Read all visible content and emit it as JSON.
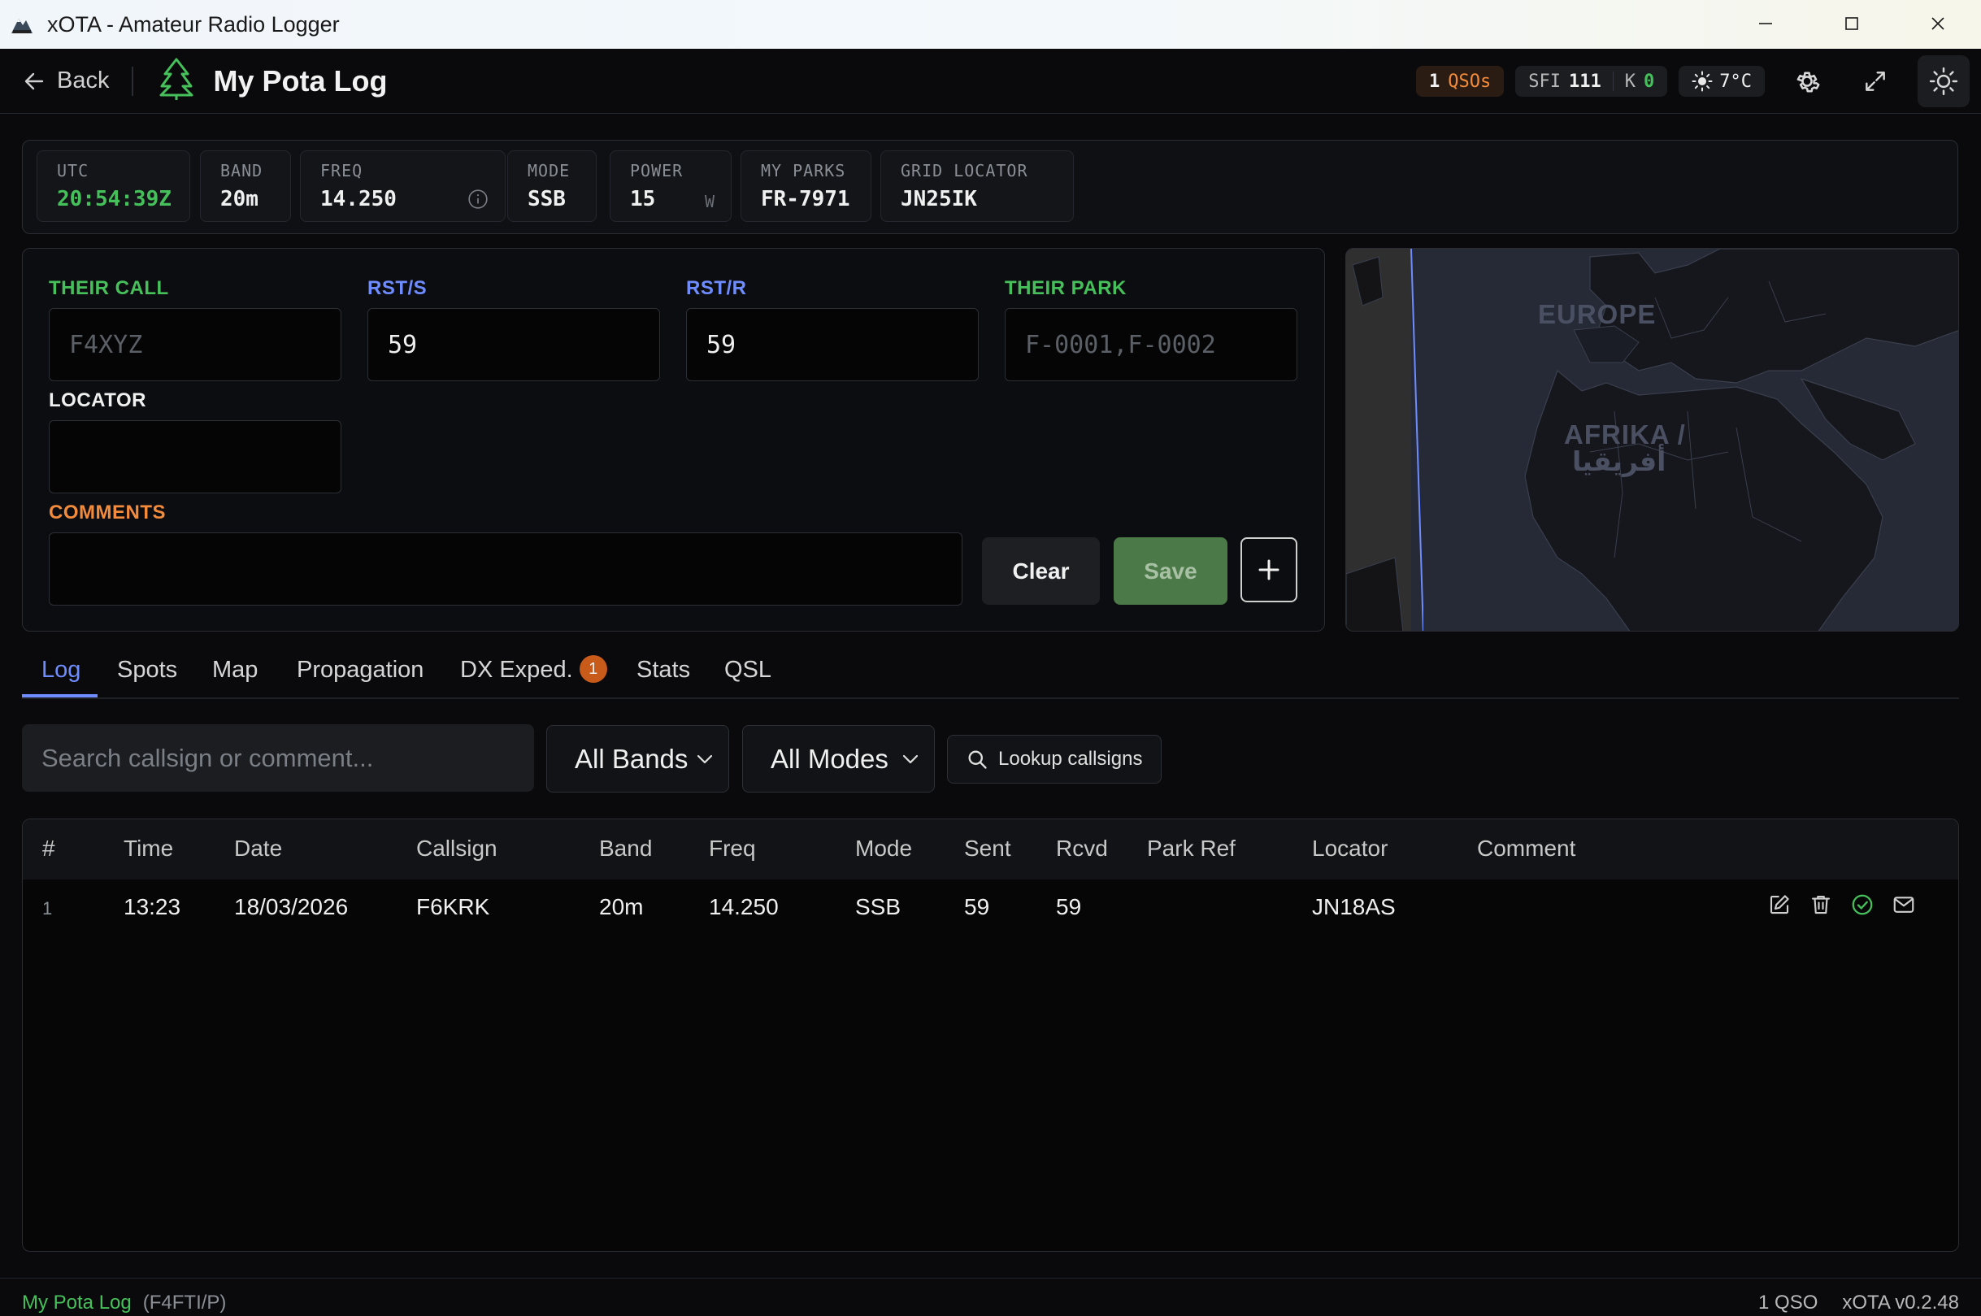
{
  "window": {
    "title": "xOTA - Amateur Radio Logger",
    "controls": [
      "minimize",
      "maximize",
      "close"
    ]
  },
  "header": {
    "back_label": "Back",
    "log_title": "My Pota Log",
    "qso_count": "1",
    "qso_unit": "QSOs",
    "sfi_label": "SFI",
    "sfi_value": "111",
    "k_label": "K",
    "k_value": "0",
    "weather": "7°C"
  },
  "status": {
    "utc_label": "UTC",
    "utc_value": "20:54:39Z",
    "band_label": "BAND",
    "band_value": "20m",
    "freq_label": "FREQ",
    "freq_value": "14.250",
    "mode_label": "MODE",
    "mode_value": "SSB",
    "power_label": "POWER",
    "power_value": "15",
    "power_unit": "W",
    "parks_label": "MY PARKS",
    "parks_value": "FR-7971",
    "grid_label": "GRID LOCATOR",
    "grid_value": "JN25IK"
  },
  "form": {
    "their_call_label": "THEIR CALL",
    "their_call_placeholder": "F4XYZ",
    "rst_s_label": "RST/S",
    "rst_s_value": "59",
    "rst_r_label": "RST/R",
    "rst_r_value": "59",
    "their_park_label": "THEIR PARK",
    "their_park_placeholder": "F-0001,F-0002",
    "locator_label": "LOCATOR",
    "locator_value": "",
    "comments_label": "COMMENTS",
    "comments_value": "",
    "clear_label": "Clear",
    "save_label": "Save",
    "plus_label": "+"
  },
  "map": {
    "label_europe": "EUROPE",
    "label_africa_1": "AFRIKA /",
    "label_africa_2": "أفريقيا"
  },
  "tabs": {
    "log": "Log",
    "spots": "Spots",
    "map": "Map",
    "propagation": "Propagation",
    "dx_exped": "DX Exped.",
    "dx_exped_badge": "1",
    "stats": "Stats",
    "qsl": "QSL"
  },
  "filters": {
    "search_placeholder": "Search callsign or comment...",
    "bands_selected": "All Bands",
    "modes_selected": "All Modes",
    "lookup_label": "Lookup callsigns"
  },
  "table": {
    "headers": [
      "#",
      "Time",
      "Date",
      "Callsign",
      "Band",
      "Freq",
      "Mode",
      "Sent",
      "Rcvd",
      "Park Ref",
      "Locator",
      "Comment"
    ],
    "rows": [
      [
        "1",
        "13:23",
        "18/03/2026",
        "F6KRK",
        "20m",
        "14.250",
        "SSB",
        "59",
        "59",
        "",
        "JN18AS",
        ""
      ]
    ]
  },
  "footer": {
    "log_name": "My Pota Log",
    "callsign": "(F4FTI/P)",
    "qso_total": "1 QSO",
    "version": "xOTA v0.2.48"
  },
  "colors": {
    "accent_blue": "#6f8cff",
    "accent_green": "#46c05a",
    "accent_orange": "#f28b3b",
    "save_green": "#4b7a48"
  }
}
